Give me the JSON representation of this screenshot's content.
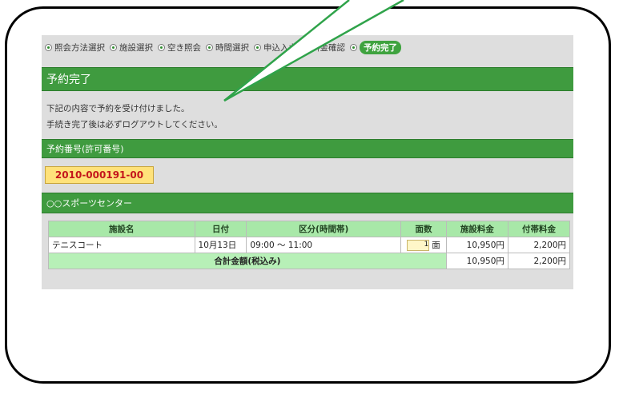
{
  "steps": [
    {
      "label": "照会方法選択",
      "active": false
    },
    {
      "label": "施設選択",
      "active": false
    },
    {
      "label": "空き照会",
      "active": false
    },
    {
      "label": "時間選択",
      "active": false
    },
    {
      "label": "申込入力",
      "active": false
    },
    {
      "label": "料金確認",
      "active": false
    },
    {
      "label": "予約完了",
      "active": true
    }
  ],
  "page_title": "予約完了",
  "messages": [
    "下記の内容で予約を受け付けました。",
    "手続き完了後は必ずログアウトしてください。"
  ],
  "reservation": {
    "section_title": "予約番号(許可番号)",
    "number": "2010-000191-00"
  },
  "facility": {
    "section_title": "○○スポーツセンター"
  },
  "table": {
    "headers": [
      "施設名",
      "日付",
      "区分(時間帯)",
      "面数",
      "施設料金",
      "付帯料金"
    ],
    "row": {
      "name": "テニスコート",
      "date": "10月13日",
      "time": "09:00 ～ 11:00",
      "qty": "1",
      "qty_unit": "面",
      "fee": "10,950円",
      "extra": "2,200円"
    },
    "total": {
      "label": "合計金額(税込み)",
      "fee": "10,950円",
      "extra": "2,200円"
    }
  },
  "colors": {
    "accent_green": "#3f9b3f",
    "header_green": "#a8e8a8",
    "reservation_bg": "#ffe27a"
  }
}
